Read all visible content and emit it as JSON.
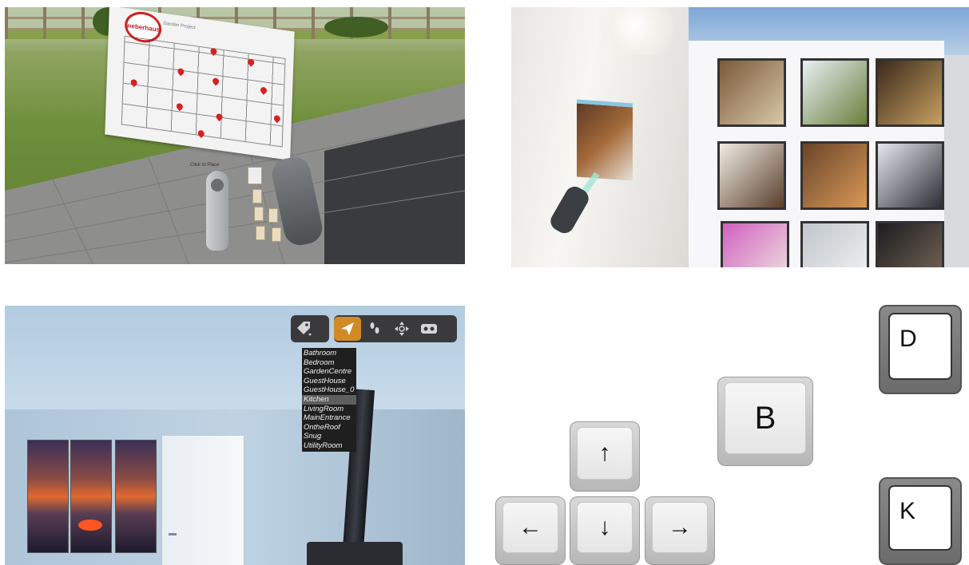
{
  "panel1": {
    "logo_text": "weberhaus",
    "plan_title": "Garden Project",
    "hand_label": "Click to Place"
  },
  "panel3": {
    "toolbar": {
      "tag_icon": "tag-dropdown-icon",
      "fly_icon": "paper-plane-icon",
      "walk_icon": "footsteps-icon",
      "move_icon": "move-arrows-icon",
      "vr_icon": "vr-headset-icon"
    },
    "location_menu": {
      "items": [
        "Bathroom",
        "Bedroom",
        "GardenCentre",
        "GuestHouse",
        "GuestHouse_0",
        "Kitchen",
        "LivingRoom",
        "MainEntrance",
        "OntheRoof",
        "Snug",
        "UtilityRoom"
      ],
      "selected": "Kitchen"
    }
  },
  "panel4": {
    "keys": {
      "up": "↑",
      "left": "←",
      "down": "↓",
      "right": "→",
      "b": "B",
      "d": "D",
      "k": "K"
    }
  },
  "colors": {
    "menu_bg": "#1f1f1f",
    "menu_selected": "#5e5e5e",
    "toolbar_active": "#d18a26",
    "pin": "#d82020"
  }
}
